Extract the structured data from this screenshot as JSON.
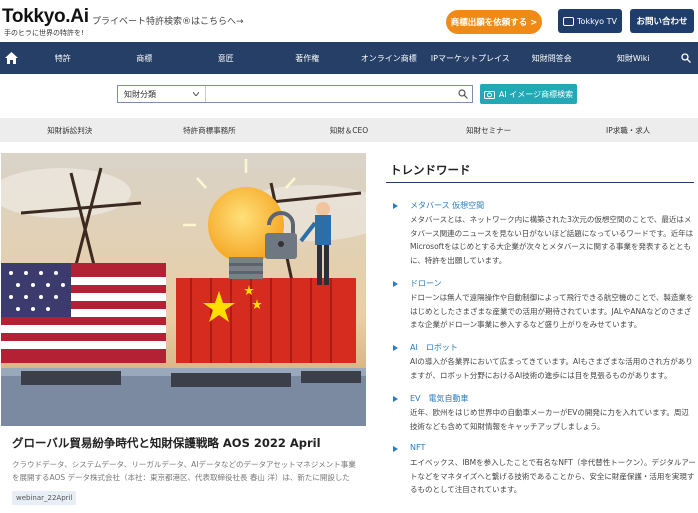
{
  "header": {
    "logo": "Tokkyo.Ai",
    "logo_tagline": "手のヒラに世界の特許を!",
    "promo_link": "プライベート特許検索®はこちらへ→",
    "order_button": "商標出願を依頼する >",
    "tv_button": "Tokkyo TV",
    "contact_button": "お問い合わせ"
  },
  "nav": {
    "items": [
      "特許",
      "商標",
      "意匠",
      "著作権",
      "オンライン商標",
      "IPマーケットプレイス",
      "知財問答会",
      "知財Wiki"
    ]
  },
  "search": {
    "category": "知財分類",
    "query": "",
    "ai_button": "AI イメージ商標検索"
  },
  "subnav": {
    "items": [
      "知財訴訟判決",
      "特許商標事務所",
      "知財＆CEO",
      "知財セミナー",
      "IP求職・求人"
    ]
  },
  "feature": {
    "title": "グローバル貿易紛争時代と知財保護戦略 AOS 2022 April",
    "description": "クラウドデータ、システムデータ、リーガルデータ、AIデータなどのデータアセットマネジメント事業を展開するAOS データ株式会社（本社：東京都港区、代表取締役社長 春山 洋）は、新たに開設した",
    "tag": "webinar_22April"
  },
  "trends": {
    "heading": "トレンドワード",
    "items": [
      {
        "title": "メタバース 仮想空間",
        "desc": "メタバースとは、ネットワーク内に構築された3次元の仮想空間のことで、最近はメタバース関連のニュースを見ない日がないほど話題になっているワードです。近年はMicrosoftをはじめとする大企業が次々とメタバースに関する事業を発表するとともに、特許を出願しています。"
      },
      {
        "title": "ドローン",
        "desc": "ドローンは無人で遠隔操作や自動制御によって飛行できる航空機のことで、製造業をはじめとしたさまざまな産業での活用が期待されています。JALやANAなどのさまざまな企業がドローン事業に参入するなど盛り上がりをみせています。"
      },
      {
        "title": "AI　ロボット",
        "desc": "AIの導入が各業界において広まってきています。AIもさまざまな活用のされ方がありますが、ロボット分野におけるAI技術の進歩には目を見張るものがあります。"
      },
      {
        "title": "EV　電気自動車",
        "desc": "近年、欧州をはじめ世界中の自動車メーカーがEVの開発に力を入れています。周辺技術なども含めて知財情報をキャッチアップしましょう。"
      },
      {
        "title": "NFT",
        "desc": "エイベックス、IBMを参入したことで有名なNFT（非代替性トークン）。デジタルアートなどをマネタイズへと繋げる技術であることから、安全に財産保護・活用を実現するものとして注目されています。"
      }
    ]
  }
}
